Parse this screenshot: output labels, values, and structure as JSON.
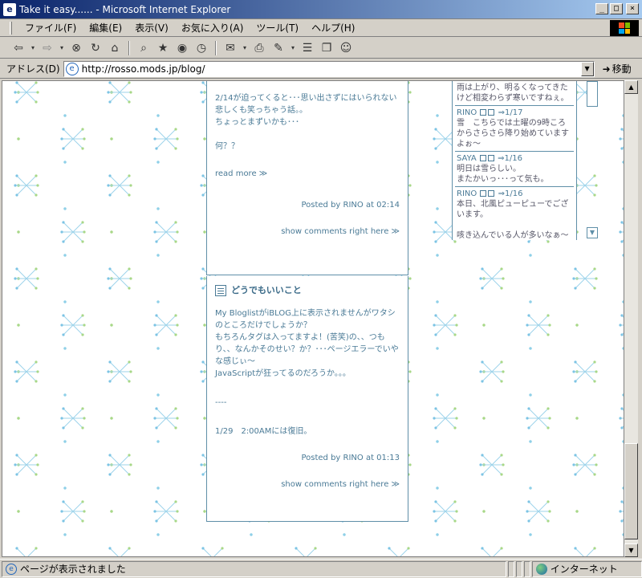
{
  "window": {
    "title": "Take it easy...... - Microsoft Internet Explorer",
    "minimize": "_",
    "maximize": "□",
    "close": "×"
  },
  "menu": [
    "ファイル(F)",
    "編集(E)",
    "表示(V)",
    "お気に入り(A)",
    "ツール(T)",
    "ヘルプ(H)"
  ],
  "toolbar": {
    "icons": [
      "back-icon",
      "forward-icon",
      "stop-icon",
      "refresh-icon",
      "home-icon",
      "search-icon",
      "favorites-icon",
      "media-icon",
      "history-icon",
      "mail-icon",
      "print-icon",
      "edit-icon",
      "discuss-icon",
      "messenger-icon"
    ]
  },
  "address": {
    "label": "アドレス(D)",
    "url": "http://rosso.mods.jp/blog/",
    "go_label": "移動"
  },
  "posts": [
    {
      "lines": [
        "2/14が迫ってくると･･･思い出さずにはいられない悲しくも笑っちゃう話。。",
        "ちょっとまずいかも･･･",
        "",
        "何？？",
        "",
        "read more ≫"
      ],
      "meta": "Posted by RINO at 02:14",
      "comments": "show comments right here ≫"
    },
    {
      "title": "どうでもいいこと",
      "lines": [
        "My BloglistがiBLOG上に表示されませんがワタシのところだけでしょうか？",
        "もちろんタグは入ってますよ！(苦笑)の、、つもり、、なんかそのせい？か？･･･ページエラーでいやな感じぃ～",
        "JavaScriptが狂ってるのだろうか。。。",
        "",
        "----",
        "",
        "1/29　2:00AMには復旧。"
      ],
      "meta": "Posted by RINO at 01:13",
      "comments": "show comments right here ≫"
    }
  ],
  "sidebar_comments": [
    {
      "who": "",
      "date": "",
      "body": "雨は上がり、明るくなってきたけど相変わらず寒いですねぇ。"
    },
    {
      "who": "RINO",
      "date": "⇒1/17",
      "body": "雪　こちらでは土曜の9時ころからさらさら降り始めていますよぉ～"
    },
    {
      "who": "SAYA",
      "date": "⇒1/16",
      "body": "明日は雪らしい。\nまたかいっ･･･って気も。"
    },
    {
      "who": "RINO",
      "date": "⇒1/16",
      "body": "本日、北風ピューピューでございます。\n\n咳き込んでいる人が多いなぁ～\nうがい、うがい！！"
    }
  ],
  "status": {
    "text": "ページが表示されました",
    "zone": "インターネット"
  }
}
